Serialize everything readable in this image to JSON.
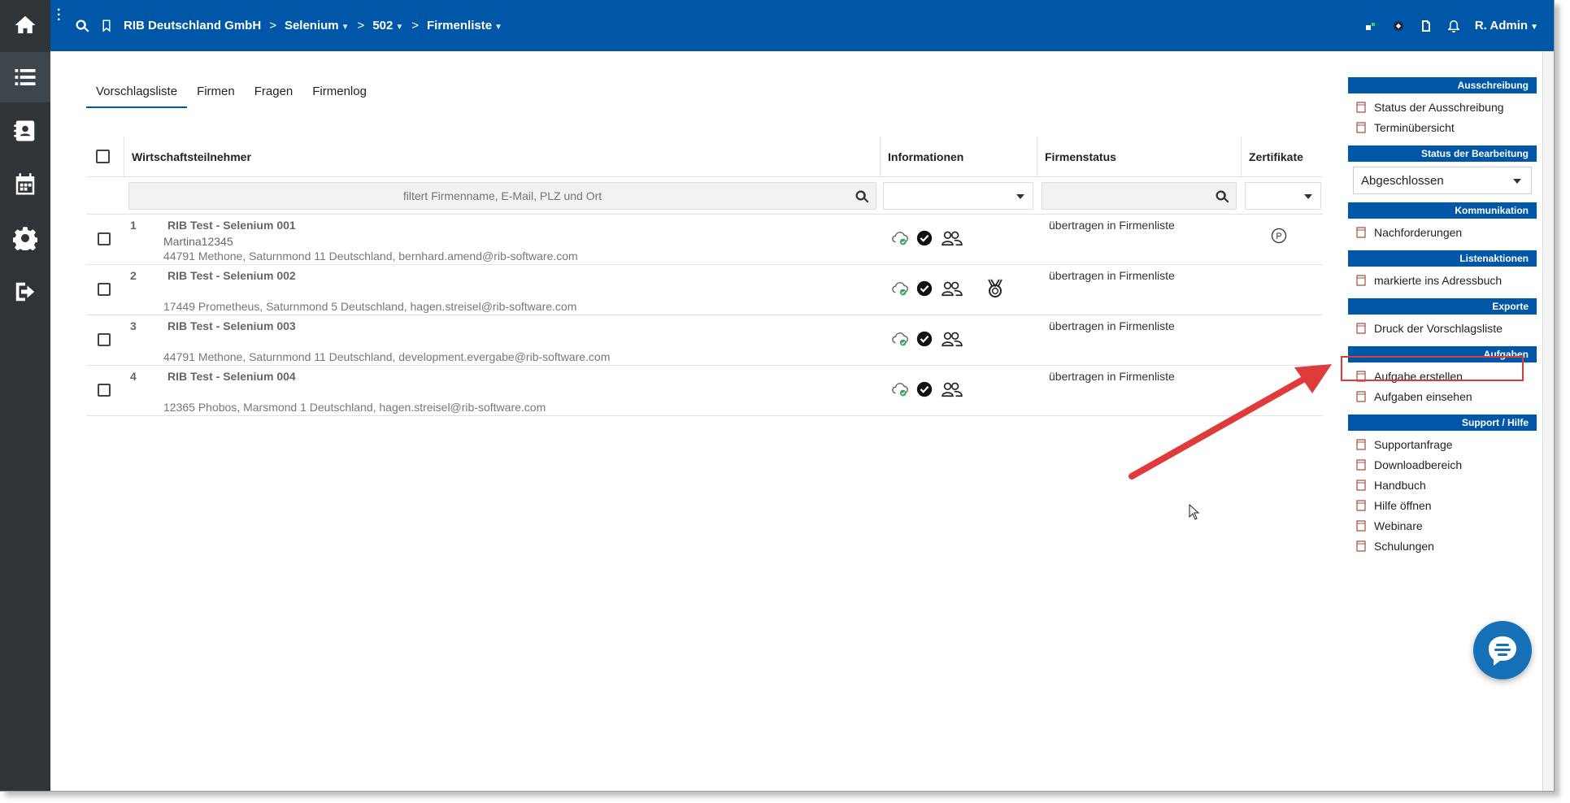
{
  "topbar": {
    "company": "RIB Deutschland GmbH",
    "project": "Selenium",
    "lot": "502",
    "page": "Firmenliste",
    "user": "R. Admin"
  },
  "tabs": [
    {
      "label": "Vorschlagsliste",
      "active": true
    },
    {
      "label": "Firmen",
      "active": false
    },
    {
      "label": "Fragen",
      "active": false
    },
    {
      "label": "Firmenlog",
      "active": false
    }
  ],
  "table": {
    "headers": {
      "company": "Wirtschaftsteilnehmer",
      "info": "Informationen",
      "status": "Firmenstatus",
      "certs": "Zertifikate"
    },
    "filter_placeholder": "filtert Firmenname, E-Mail, PLZ und Ort",
    "rows": [
      {
        "num": "1",
        "name": "RIB Test - Selenium 001",
        "contact": "Martina12345",
        "address": "44791 Methone, Saturnmond 11 Deutschland, bernhard.amend@rib-software.com",
        "status": "übertragen in Firmenliste"
      },
      {
        "num": "2",
        "name": "RIB Test - Selenium 002",
        "contact": "",
        "address": "17449 Prometheus, Saturnmond 5 Deutschland, hagen.streisel@rib-software.com",
        "status": "übertragen in Firmenliste"
      },
      {
        "num": "3",
        "name": "RIB Test - Selenium 003",
        "contact": "",
        "address": "44791 Methone, Saturnmond 11 Deutschland, development.evergabe@rib-software.com",
        "status": "übertragen in Firmenliste"
      },
      {
        "num": "4",
        "name": "RIB Test - Selenium 004",
        "contact": "",
        "address": "12365 Phobos, Marsmond 1 Deutschland, hagen.streisel@rib-software.com",
        "status": "übertragen in Firmenliste"
      }
    ]
  },
  "panel": {
    "ausschreibung": {
      "title": "Ausschreibung",
      "items": [
        "Status der Ausschreibung",
        "Terminübersicht"
      ]
    },
    "bearbeitung": {
      "title": "Status der Bearbeitung",
      "selected": "Abgeschlossen"
    },
    "kommunikation": {
      "title": "Kommunikation",
      "items": [
        "Nachforderungen"
      ]
    },
    "listenaktionen": {
      "title": "Listenaktionen",
      "items": [
        "markierte ins Adressbuch"
      ]
    },
    "exporte": {
      "title": "Exporte",
      "items": [
        "Druck der Vorschlagsliste"
      ]
    },
    "aufgaben": {
      "title": "Aufgaben",
      "items": [
        "Aufgabe erstellen",
        "Aufgaben einsehen"
      ]
    },
    "support": {
      "title": "Support / Hilfe",
      "items": [
        "Supportanfrage",
        "Downloadbereich",
        "Handbuch",
        "Hilfe öffnen",
        "Webinare",
        "Schulungen"
      ]
    }
  },
  "colors": {
    "brand": "#0057a8",
    "rail": "#2f3438",
    "annotation": "#e03b3b"
  },
  "icons": [
    "home-icon",
    "list-icon",
    "contacts-icon",
    "calendar-icon",
    "gear-icon",
    "logout-icon",
    "search-icon",
    "bookmark-icon",
    "bell-icon",
    "chat-icon"
  ]
}
